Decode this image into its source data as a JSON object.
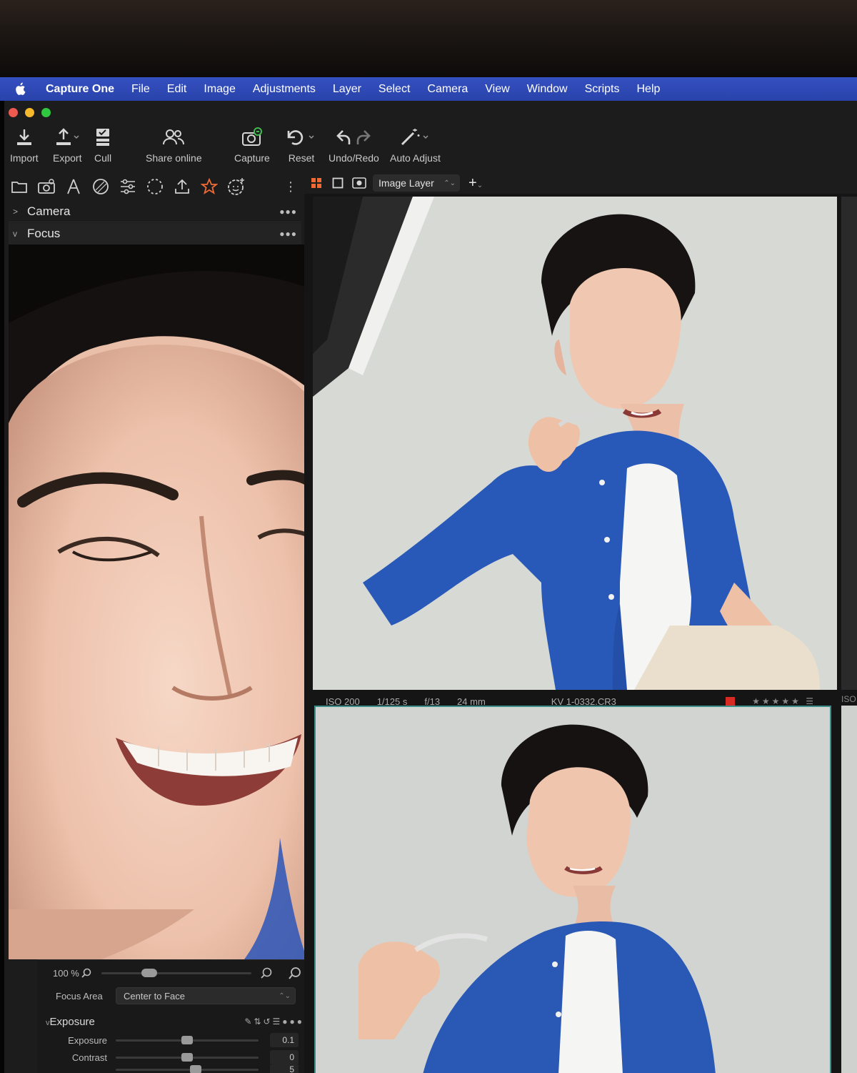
{
  "menubar": {
    "apple_icon": "apple-logo-icon",
    "items": [
      "Capture One",
      "File",
      "Edit",
      "Image",
      "Adjustments",
      "Layer",
      "Select",
      "Camera",
      "View",
      "Window",
      "Scripts",
      "Help"
    ]
  },
  "toolbar": {
    "import": "Import",
    "export": "Export",
    "cull": "Cull",
    "share": "Share online",
    "capture": "Capture",
    "reset": "Reset",
    "undo_redo": "Undo/Redo",
    "auto_adjust": "Auto Adjust"
  },
  "tool_tabs": [
    "folder-icon",
    "camera-icon",
    "lens-icon",
    "color-icon",
    "sliders-icon",
    "dashed-circle-icon",
    "upload-icon",
    "star-icon",
    "face-sparkle-icon"
  ],
  "panels": {
    "camera": "Camera",
    "focus": "Focus",
    "zoom_percent": "100 %",
    "focus_area_label": "Focus Area",
    "focus_area_value": "Center to Face",
    "exposure_section": "Exposure",
    "exposure_label": "Exposure",
    "exposure_value": "0.1",
    "contrast_label": "Contrast",
    "contrast_value": "0",
    "third_value": "5"
  },
  "viewer": {
    "layer": "Image Layer"
  },
  "thumbnail_1": {
    "iso": "ISO 200",
    "shutter": "1/125 s",
    "aperture": "f/13",
    "focal": "24 mm",
    "filename": "KV 1-0332.CR3",
    "color_tag": "#d62a22",
    "rating_stars": 5
  },
  "neighbor_label": "ISO",
  "colors": {
    "menubar": "#2f4ab6",
    "accent": "#ef6a34",
    "selection": "#3c8f88"
  }
}
